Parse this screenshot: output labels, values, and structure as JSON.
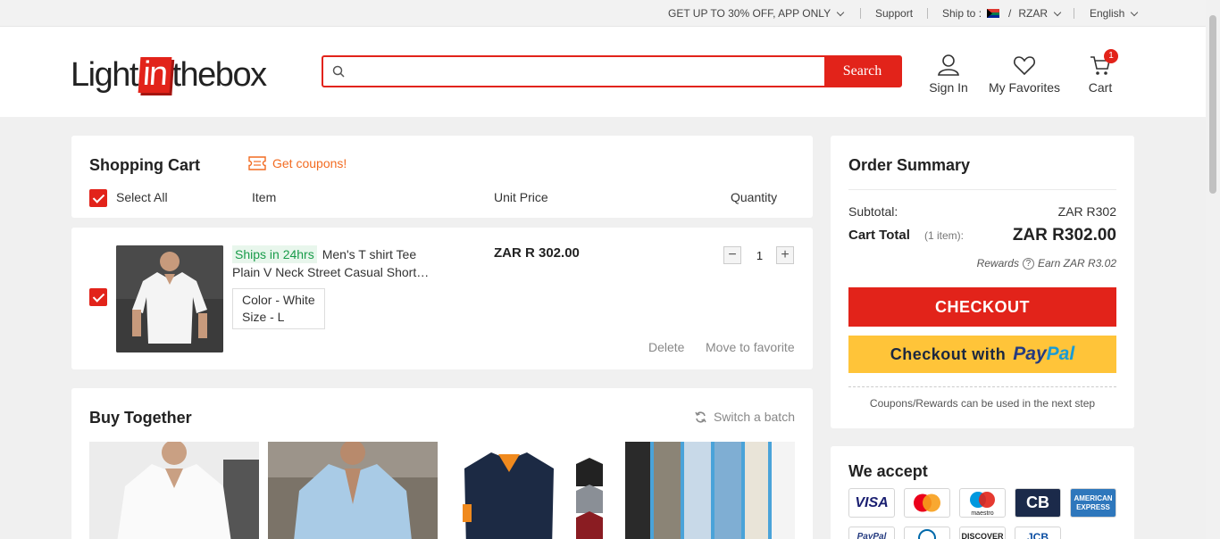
{
  "topbar": {
    "promo": "GET UP TO 30% OFF, APP ONLY",
    "support": "Support",
    "ship_to_label": "Ship to :",
    "currency": "RZAR",
    "language": "English"
  },
  "header": {
    "logo_left": "Light",
    "logo_in": "in",
    "logo_right": "thebox",
    "search_placeholder": "",
    "search_button": "Search",
    "sign_in": "Sign In",
    "favorites": "My Favorites",
    "cart": "Cart",
    "cart_count": "1"
  },
  "cart": {
    "title": "Shopping Cart",
    "coupons": "Get coupons!",
    "select_all": "Select All",
    "col_item": "Item",
    "col_unit_price": "Unit Price",
    "col_quantity": "Quantity",
    "item": {
      "ship_tag": "Ships in 24hrs",
      "name_line1": "Men's T shirt Tee",
      "name_line2": "Plain V Neck Street Casual Short…",
      "color": "Color - White",
      "size": "Size - L",
      "price": "ZAR R 302.00",
      "qty_minus": "−",
      "qty": "1",
      "qty_plus": "+",
      "delete": "Delete",
      "move_to_favorite": "Move to favorite"
    }
  },
  "buy_together": {
    "title": "Buy Together",
    "switch_batch": "Switch a batch"
  },
  "summary": {
    "title": "Order Summary",
    "subtotal_label": "Subtotal:",
    "subtotal_value": "ZAR R302",
    "total_label": "Cart Total",
    "total_items": "(1 item):",
    "total_value": "ZAR R302.00",
    "rewards_label": "Rewards",
    "rewards_value": "Earn ZAR R3.02",
    "checkout": "CHECKOUT",
    "paypal_prefix": "Checkout with",
    "paypal_pay": "Pay",
    "paypal_pal": "Pal",
    "coupon_note": "Coupons/Rewards can be used in the next step"
  },
  "accept": {
    "title": "We accept",
    "visa": "VISA",
    "maestro": "maestro",
    "cb": "CB",
    "amex_1": "AMERICAN",
    "amex_2": "EXPRESS",
    "paypal": "PayPal",
    "discover": "DISCOVER",
    "jcb": "JCB"
  },
  "colors": {
    "brand_red": "#e2231a",
    "paypal_yellow": "#ffc439",
    "ship_green": "#1a9c4b",
    "coupon_orange": "#f26b21"
  }
}
